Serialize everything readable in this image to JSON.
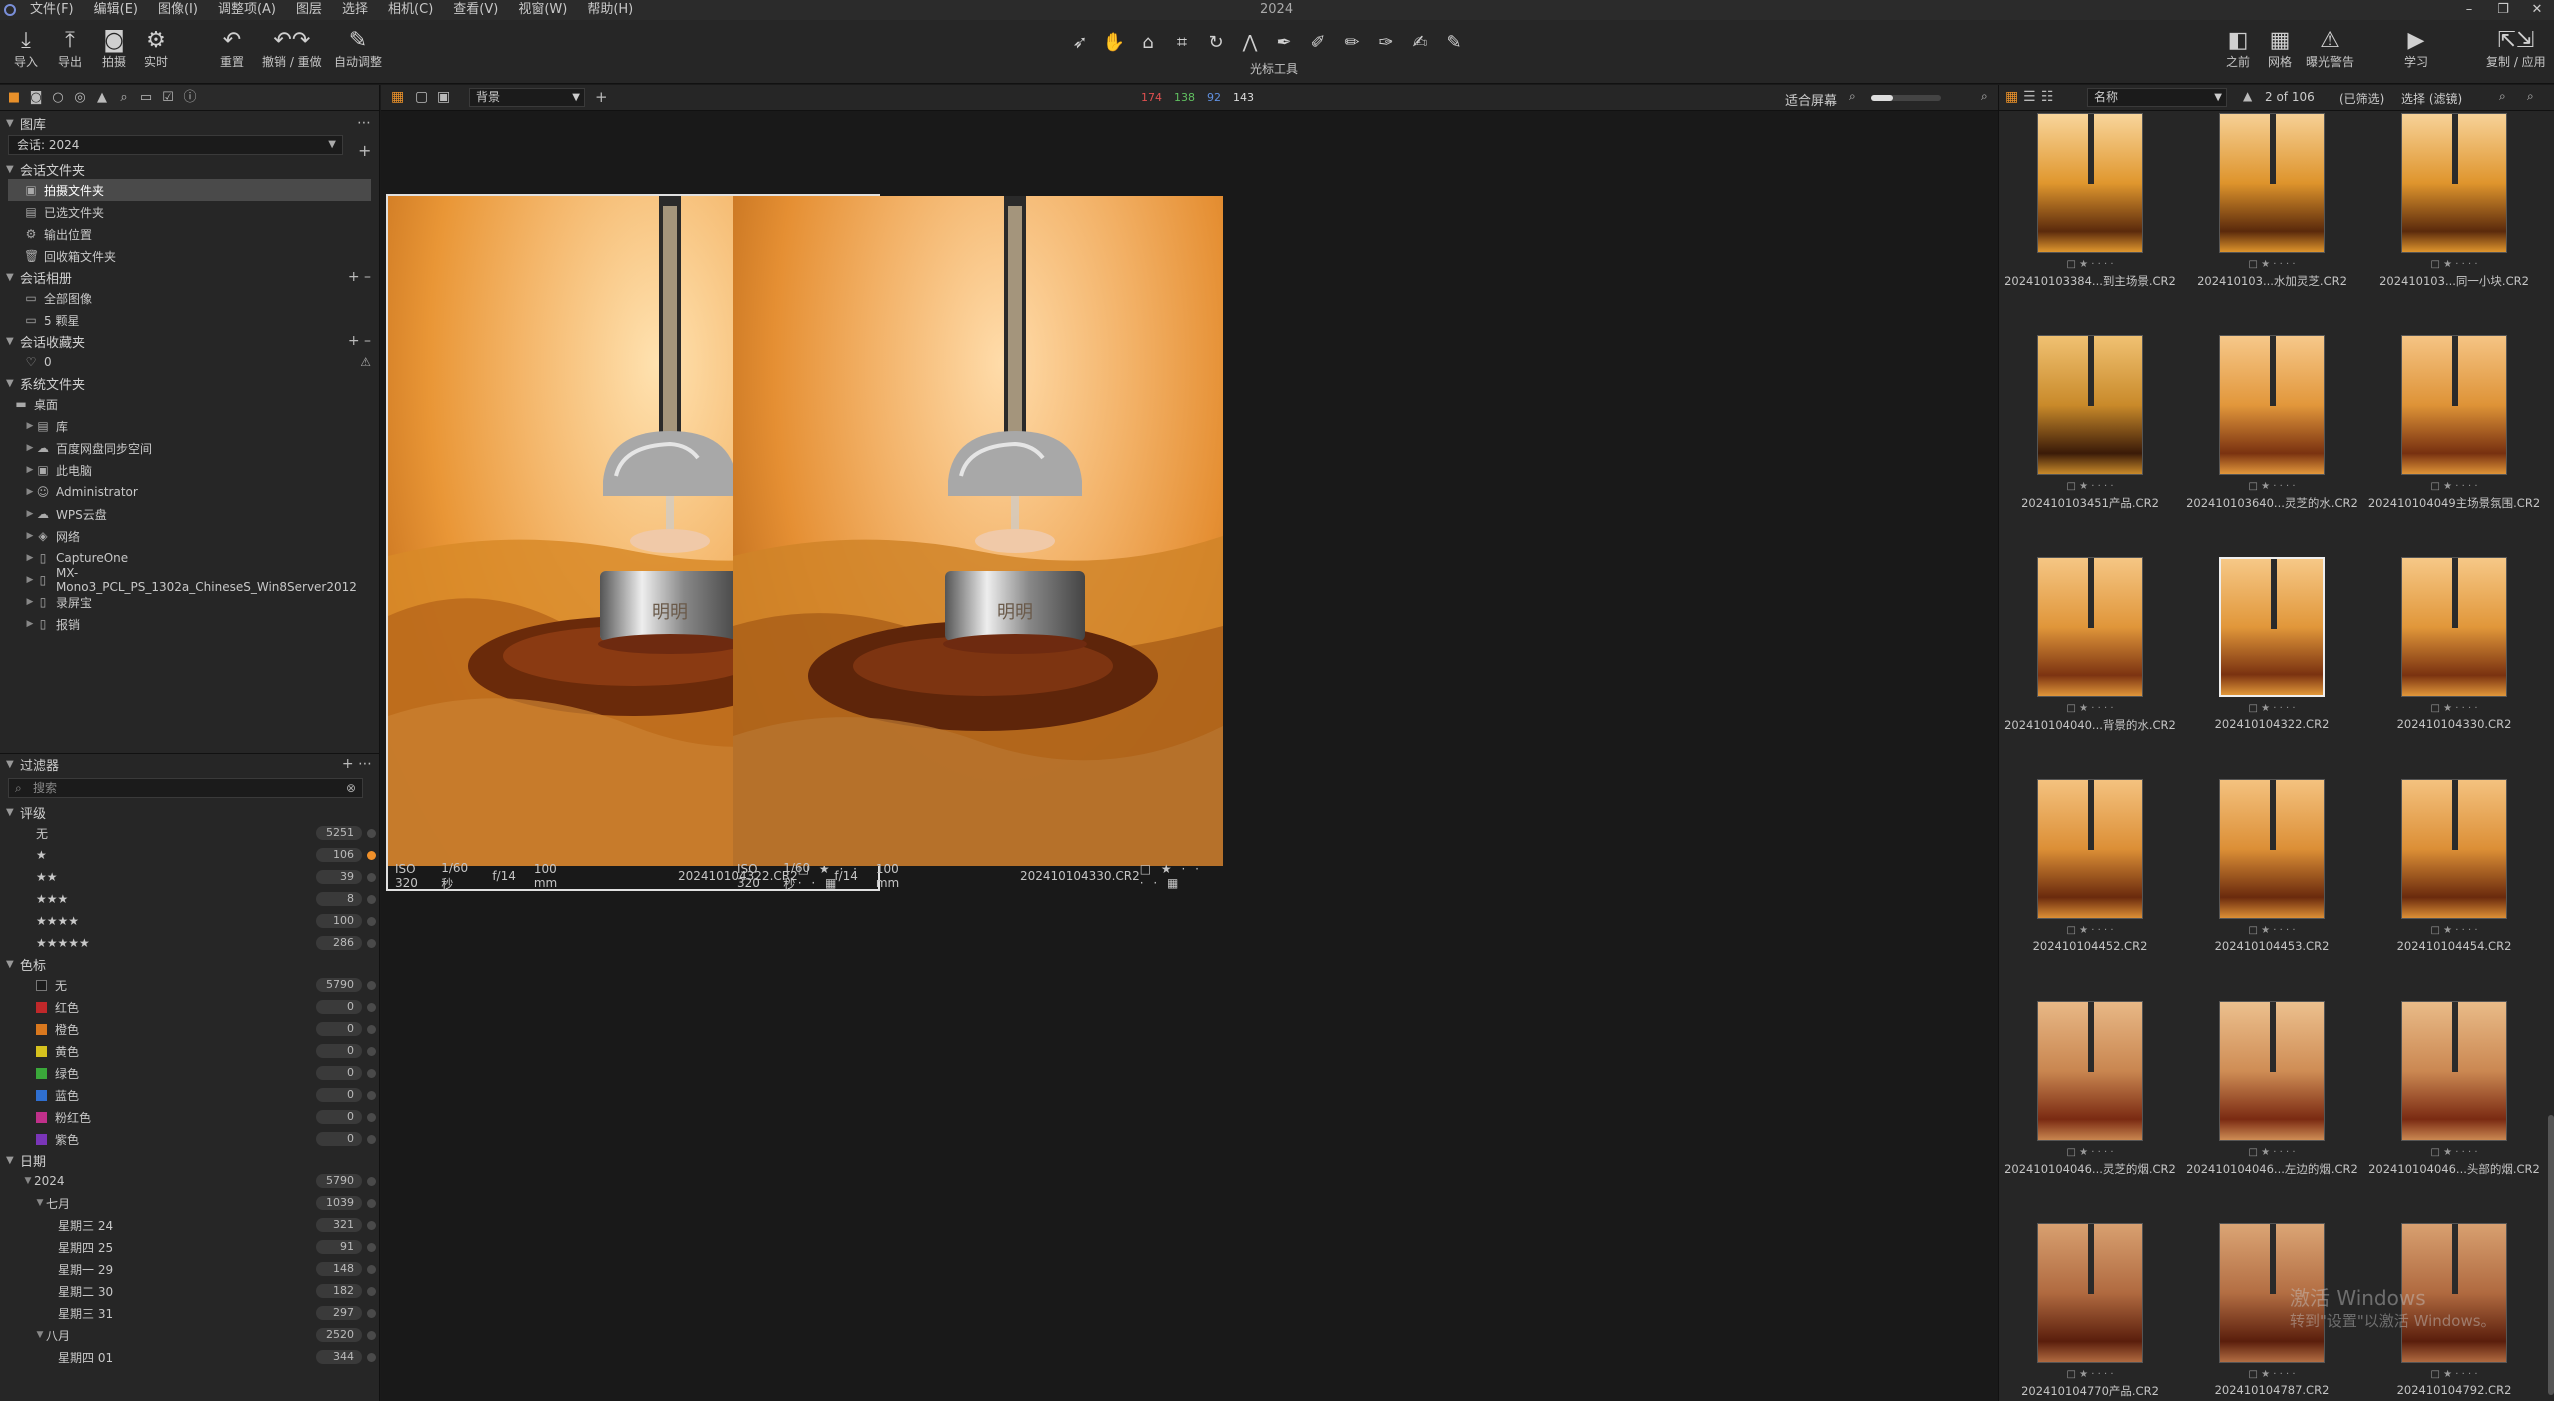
{
  "window": {
    "title": "2024"
  },
  "menu": [
    "文件(F)",
    "编辑(E)",
    "图像(I)",
    "调整项(A)",
    "图层",
    "选择",
    "相机(C)",
    "查看(V)",
    "视窗(W)",
    "帮助(H)"
  ],
  "toolbar": {
    "left": [
      {
        "label": "导入",
        "icon": "import-icon"
      },
      {
        "label": "导出",
        "icon": "export-icon"
      },
      {
        "label": "拍摄",
        "icon": "camera-icon"
      },
      {
        "label": "实时",
        "icon": "live-icon"
      }
    ],
    "undo": [
      {
        "label": "重置",
        "icon": "reset-icon"
      },
      {
        "label": "撤销 / 重做",
        "icon": "undo-redo-icon"
      },
      {
        "label": "自动调整",
        "icon": "magic-wand-icon"
      }
    ],
    "cursor_label": "光标工具",
    "right": [
      {
        "label": "之前",
        "icon": "before-icon"
      },
      {
        "label": "网格",
        "icon": "grid-icon"
      },
      {
        "label": "曝光警告",
        "icon": "warning-icon"
      },
      {
        "label": "学习",
        "icon": "learn-icon"
      },
      {
        "label": "复制 / 应用",
        "icon": "copy-apply-icon"
      }
    ]
  },
  "library": {
    "title": "图库",
    "session": "会话: 2024",
    "session_folders_title": "会话文件夹",
    "session_folders": [
      "拍摄文件夹",
      "已选文件夹",
      "输出位置",
      "回收箱文件夹"
    ],
    "session_albums_title": "会话相册",
    "session_albums": [
      "全部图像",
      "5 颗星"
    ],
    "session_favorites_title": "会话收藏夹",
    "favorites_count": "0",
    "system_folders_title": "系统文件夹",
    "desktop": "桌面",
    "system_folders": [
      "库",
      "百度网盘同步空间",
      "此电脑",
      "Administrator",
      "WPS云盘",
      "网络",
      "CaptureOne",
      "MX-Mono3_PCL_PS_1302a_ChineseS_Win8Server2012",
      "录屏宝",
      "报销"
    ]
  },
  "filters": {
    "title": "过滤器",
    "search_placeholder": "搜索",
    "rating_title": "评级",
    "ratings": [
      {
        "label": "无",
        "count": "5251"
      },
      {
        "label": "★",
        "count": "106"
      },
      {
        "label": "★★",
        "count": "39"
      },
      {
        "label": "★★★",
        "count": "8"
      },
      {
        "label": "★★★★",
        "count": "100"
      },
      {
        "label": "★★★★★",
        "count": "286"
      }
    ],
    "color_title": "色标",
    "colors": [
      {
        "label": "无",
        "count": "5790",
        "color": "#1b1b1b"
      },
      {
        "label": "红色",
        "count": "0",
        "color": "#c0282a"
      },
      {
        "label": "橙色",
        "count": "0",
        "color": "#d9781e"
      },
      {
        "label": "黄色",
        "count": "0",
        "color": "#d6c21e"
      },
      {
        "label": "绿色",
        "count": "0",
        "color": "#3aa83a"
      },
      {
        "label": "蓝色",
        "count": "0",
        "color": "#2f6fd0"
      },
      {
        "label": "粉红色",
        "count": "0",
        "color": "#c0308a"
      },
      {
        "label": "紫色",
        "count": "0",
        "color": "#7a35b8"
      }
    ],
    "date_title": "日期",
    "year": {
      "label": "2024",
      "count": "5790"
    },
    "july": {
      "label": "七月",
      "count": "1039"
    },
    "july_days": [
      {
        "label": "星期三 24",
        "count": "321"
      },
      {
        "label": "星期四 25",
        "count": "91"
      },
      {
        "label": "星期一 29",
        "count": "148"
      },
      {
        "label": "星期二 30",
        "count": "182"
      },
      {
        "label": "星期三 31",
        "count": "297"
      }
    ],
    "august": {
      "label": "八月",
      "count": "2520"
    },
    "august_days": [
      {
        "label": "星期四 01",
        "count": "344"
      }
    ]
  },
  "viewer": {
    "bg_select": "背景",
    "rgb": {
      "r": "174",
      "g": "138",
      "b": "92",
      "a": "143"
    },
    "fit": "适合屏幕",
    "left_image": {
      "iso": "ISO 320",
      "shutter": "1/60 秒",
      "aperture": "f/14",
      "focal": "100 mm",
      "name": "202410104322.CR2"
    },
    "right_image": {
      "iso": "ISO 320",
      "shutter": "1/60 秒",
      "aperture": "f/14",
      "focal": "100 mm",
      "name": "202410104330.CR2"
    },
    "brand_text": "明明"
  },
  "browser": {
    "sort": "名称",
    "count": "2 of 106",
    "filter_label": "(已筛选)",
    "select_label": "选择 (滤镜)",
    "thumbs": [
      "202410103384...到主场景.CR2",
      "202410103...水加灵芝.CR2",
      "202410103...同一小块.CR2",
      "202410103451产品.CR2",
      "202410103640...灵芝的水.CR2",
      "202410104049主场景氛围.CR2",
      "202410104040...背景的水.CR2",
      "202410104322.CR2",
      "202410104330.CR2",
      "202410104452.CR2",
      "202410104453.CR2",
      "202410104454.CR2",
      "202410104046...灵芝的烟.CR2",
      "202410104046...左边的烟.CR2",
      "202410104046...头部的烟.CR2",
      "202410104770产品.CR2",
      "202410104787.CR2",
      "202410104792.CR2"
    ],
    "stars": "□ ★ · · · ·"
  },
  "watermark": {
    "line1": "激活 Windows",
    "line2": "转到\"设置\"以激活 Windows。"
  }
}
